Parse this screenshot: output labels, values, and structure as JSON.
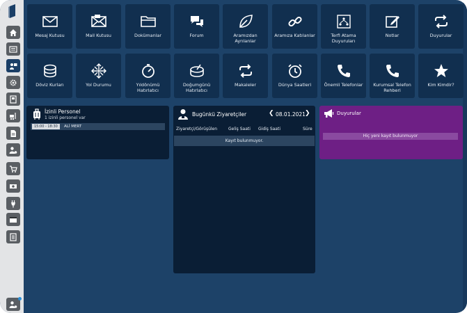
{
  "sidebar": {
    "items": [
      {
        "icon": "home-icon"
      },
      {
        "icon": "list-icon"
      },
      {
        "icon": "user-presentation-icon",
        "active": true
      },
      {
        "icon": "gear-icon"
      },
      {
        "icon": "book-icon"
      },
      {
        "icon": "forklift-icon"
      },
      {
        "icon": "document-icon"
      },
      {
        "icon": "user-settings-icon"
      },
      {
        "icon": "cart-icon"
      },
      {
        "icon": "money-icon"
      },
      {
        "icon": "plug-icon"
      },
      {
        "icon": "window-icon"
      },
      {
        "icon": "checklist-icon"
      }
    ],
    "bottom_icon": "user-settings-icon"
  },
  "tiles_row1": [
    {
      "label": "Mesaj Kutusu",
      "icon": "envelope-icon"
    },
    {
      "label": "Mail Kutusu",
      "icon": "mail-open-icon"
    },
    {
      "label": "Dokümanlar",
      "icon": "folder-icon"
    },
    {
      "label": "Forum",
      "icon": "chat-bubbles-icon"
    },
    {
      "label": "Aramızdan Ayrılanlar",
      "icon": "leaf-icon"
    },
    {
      "label": "Aramıza Katılanlar",
      "icon": "chain-link-icon"
    },
    {
      "label": "Terfi Atama Duyuruları",
      "icon": "org-chart-icon"
    },
    {
      "label": "Notlar",
      "icon": "edit-note-icon"
    },
    {
      "label": "Duyurular",
      "icon": "repeat-arrows-icon"
    }
  ],
  "tiles_row2": [
    {
      "label": "Döviz Kurları",
      "icon": "coins-icon"
    },
    {
      "label": "Yol Durumu",
      "icon": "arrows-cross-icon"
    },
    {
      "label": "Yıldönümü Hatırlatıcı",
      "icon": "stopwatch-icon"
    },
    {
      "label": "Doğumgünü Hatırlatıcı",
      "icon": "cake-icon"
    },
    {
      "label": "Makaleler",
      "icon": "repeat-arrows-icon"
    },
    {
      "label": "Dünya Saatleri",
      "icon": "alarm-clock-icon"
    },
    {
      "label": "Önemli Telefonlar",
      "icon": "phone-icon"
    },
    {
      "label": "Kurumsal Telefon Rehberi",
      "icon": "phone-icon"
    },
    {
      "label": "Kim Kimdir?",
      "icon": "star-icon"
    }
  ],
  "izinli": {
    "title": "İzinli Personel",
    "subtitle": "1 izinli personel var",
    "rows": [
      {
        "time": "15:00 - 18:30",
        "name": "ALİ MERT"
      }
    ]
  },
  "ziyaret": {
    "title": "Bugünkü Ziyaretçiler",
    "date": "08.01.2021",
    "prev": "❮",
    "next": "❯",
    "columns": [
      "Ziyaretçi/Görüşülen",
      "Geliş Saati",
      "Gidiş Saati",
      "Süre"
    ],
    "empty_text": "Kayıt bulunmuyor."
  },
  "duyuru": {
    "title": "Duyurular",
    "empty_text": "Hiç yeni kayıt bulunmuyor"
  },
  "colors": {
    "background": "#1d4268",
    "tile": "#112f4f",
    "panel": "#0a1e35",
    "announcement": "#6e1f85",
    "sidebar": "#e3e4e6",
    "sidebar_button": "#5a5e63",
    "sidebar_active": "#1a3e66"
  }
}
